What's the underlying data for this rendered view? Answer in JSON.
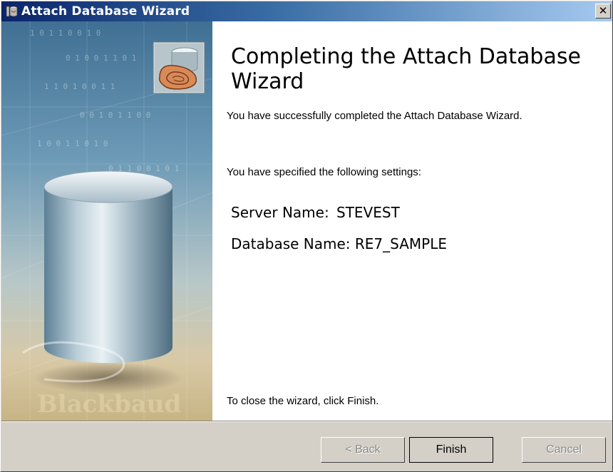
{
  "window": {
    "title": "Attach Database Wizard",
    "close_glyph": "✕"
  },
  "sidebar": {
    "watermark": "Blackbaud",
    "binary_rows": [
      "1 0 1 1 0 0 1 0",
      "0 1 0 0 1 1 0 1",
      "1 1 0 1 0 0 1 1",
      "0 0 1 0 1 1 0 0",
      "1 0 0 1 1 0 1 0",
      "0 1 1 0 0 1 0 1"
    ]
  },
  "main": {
    "heading": "Completing the Attach Database Wizard",
    "success_message": "You have successfully completed the Attach Database Wizard.",
    "settings_intro": "You have specified the following settings:",
    "settings": [
      {
        "label": "Server Name:",
        "value": "STEVEST"
      },
      {
        "label": "Database Name:",
        "value": "RE7_SAMPLE"
      }
    ],
    "close_hint": "To close the wizard, click Finish."
  },
  "buttons": {
    "back": "< Back",
    "finish": "Finish",
    "cancel": "Cancel"
  },
  "colors": {
    "titlebar_start": "#0a246a",
    "titlebar_end": "#a6caf0",
    "dialog_face": "#d4d0c8"
  },
  "icons": {
    "title": "database-wizard-icon",
    "badge": "database-attach-icon"
  }
}
